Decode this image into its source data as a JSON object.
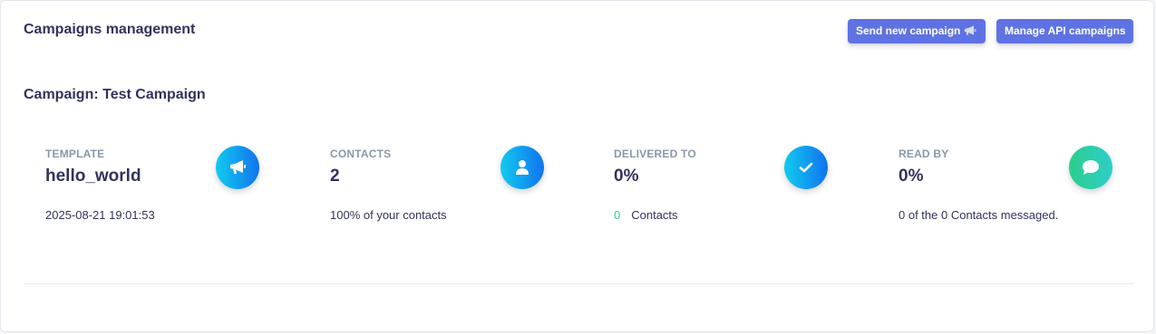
{
  "header": {
    "title": "Campaigns management",
    "send_button": "Send new campaign",
    "send_button_icon": "megaphone-icon",
    "api_button": "Manage API campaigns"
  },
  "campaign": {
    "title": "Campaign: Test Campaign"
  },
  "stats": {
    "template": {
      "label": "TEMPLATE",
      "value": "hello_world",
      "footer": "2025-08-21 19:01:53",
      "icon": "megaphone-icon",
      "color": "#1171ef"
    },
    "contacts": {
      "label": "CONTACTS",
      "value": "2",
      "footer": "100% of your contacts",
      "icon": "user-icon",
      "color": "#1171ef"
    },
    "delivered": {
      "label": "DELIVERED TO",
      "value": "0%",
      "footer_count": "0",
      "footer_text": "Contacts",
      "icon": "checkmark-icon",
      "color": "#1171ef"
    },
    "read": {
      "label": "READ BY",
      "value": "0%",
      "footer": "0 of the 0 Contacts messaged.",
      "icon": "chat-bubble-icon",
      "color": "#2dce89"
    }
  },
  "colors": {
    "primary": "#5e72e4",
    "success": "#2dce89",
    "heading": "#32325d",
    "muted": "#8898aa"
  }
}
